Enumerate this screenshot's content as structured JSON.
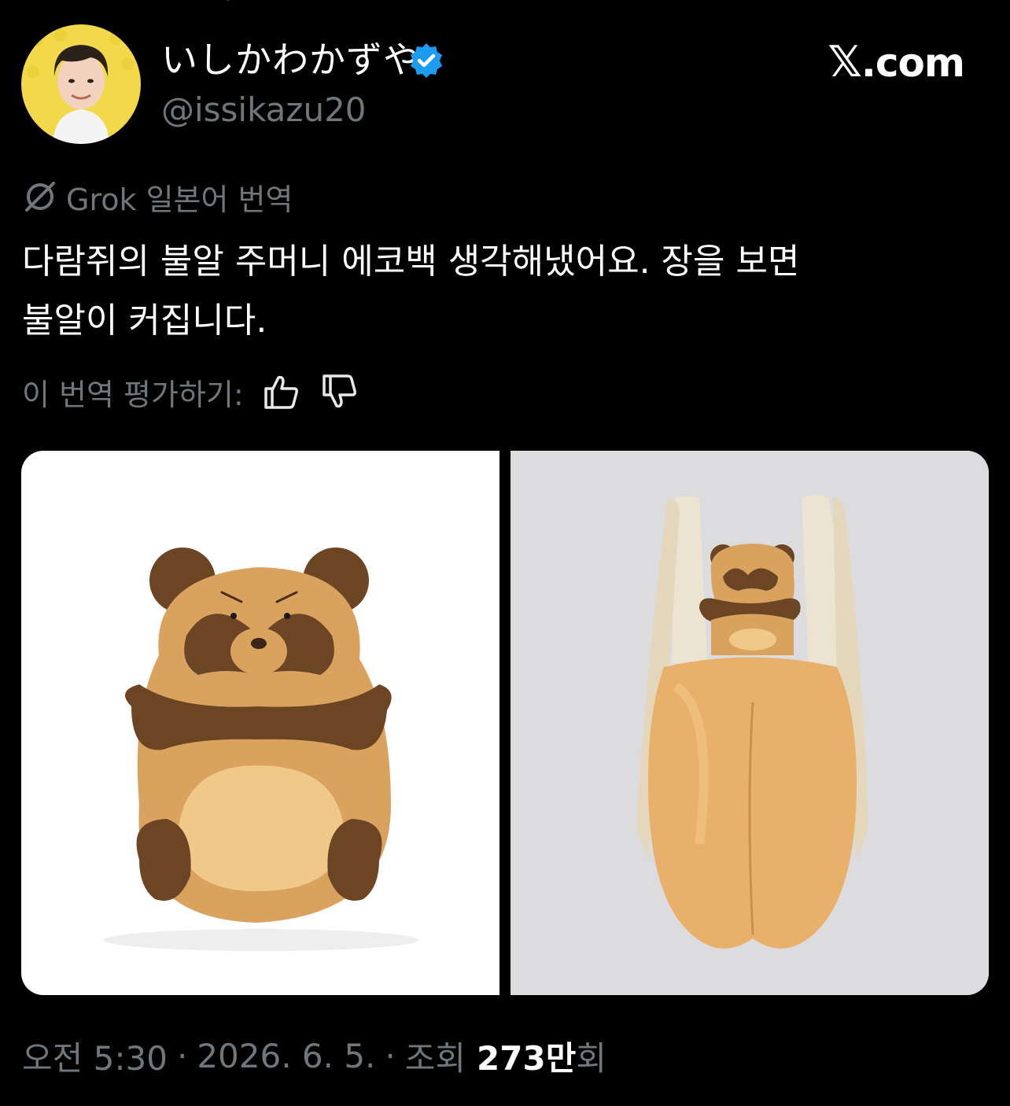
{
  "author": {
    "display_name": "いしかわかずや",
    "handle": "@issikazu20",
    "verified": true,
    "avatar_icon": "avatar-photo"
  },
  "brand": {
    "x_glyph": "𝕏",
    "suffix": ".com"
  },
  "translation": {
    "source_label": "Grok 일본어 번역",
    "icon": "grok-icon"
  },
  "tweet": {
    "lines": [
      "다람쥐의 불알 주머니 에코백 생각해냈어요. 장을 보면",
      "불알이 커집니다."
    ]
  },
  "rating": {
    "label": "이 번역 평가하기:",
    "like_icon": "thumbs-up-icon",
    "dislike_icon": "thumbs-down-icon"
  },
  "meta": {
    "time": "오전 5:30",
    "date": "2026. 6. 5.",
    "views_prefix": "조회",
    "views_count": "273만",
    "views_suffix": "회",
    "separator": "·"
  },
  "colors": {
    "background": "#000000",
    "text": "#e7e9ea",
    "muted": "#71767b",
    "verified": "#1d9bf0",
    "plush_tan": "#d9a35f",
    "plush_brown": "#6b4524"
  }
}
